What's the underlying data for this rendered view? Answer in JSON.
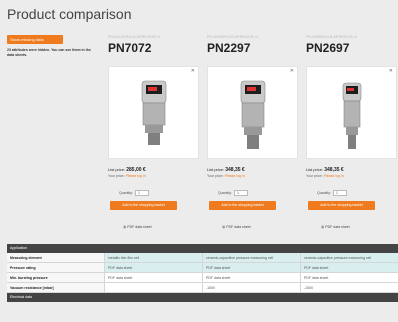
{
  "page": {
    "title": "Product comparison"
  },
  "side": {
    "show_missing_button": "Show missing data",
    "note": "23 attributes were hidden. You can see them in the data sheets."
  },
  "products": [
    {
      "code": "PN-010-SER14-B-MFRKG/US/ /V",
      "name": "PN7072",
      "list_price_label": "List price:",
      "list_price": "285,00 €",
      "your_price_label": "Your price:",
      "your_price": "Please log in",
      "qty_label": "Quantity:",
      "qty_value": "1",
      "cart_button": "Add to the shopping basket",
      "pdf_label": "PDF data sheet"
    },
    {
      "code": "PN-400SBR14-B-MFRKG/US/ /V",
      "name": "PN2297",
      "list_price_label": "List price:",
      "list_price": "348,35 €",
      "your_price_label": "Your price:",
      "your_price": "Please log in",
      "qty_label": "Quantity:",
      "qty_value": "1",
      "cart_button": "Add to the shopping basket",
      "pdf_label": "PDF data sheet"
    },
    {
      "code": "PN-025SBR14-B-MFRKG/US/ /V",
      "name": "PN2697",
      "list_price_label": "List price:",
      "list_price": "348,35 €",
      "your_price_label": "Your price:",
      "your_price": "Please log in",
      "qty_label": "Quantity:",
      "qty_value": "1",
      "cart_button": "Add to the shopping basket",
      "pdf_label": "PDF data sheet"
    }
  ],
  "table": {
    "section1": "Application",
    "rows": [
      {
        "label": "Measuring element",
        "values": [
          "metallic thin film cell",
          "ceramic-capacitive pressure measuring cell",
          "ceramic-capacitive pressure measuring cell"
        ]
      },
      {
        "label": "Pressure rating",
        "values": [
          "PDF data sheet",
          "PDF data sheet",
          "PDF data sheet"
        ]
      },
      {
        "label": "Min. bursting pressure",
        "values": [
          "PDF data sheet",
          "PDF data sheet",
          "PDF data sheet"
        ]
      },
      {
        "label": "Vacuum resistance [mbar]",
        "values": [
          "",
          "-1000",
          "-1000"
        ]
      }
    ],
    "section2": "Electrical data"
  },
  "colors": {
    "accent": "#f07b1e",
    "table_header": "#444444",
    "highlight": "#d9efef"
  }
}
